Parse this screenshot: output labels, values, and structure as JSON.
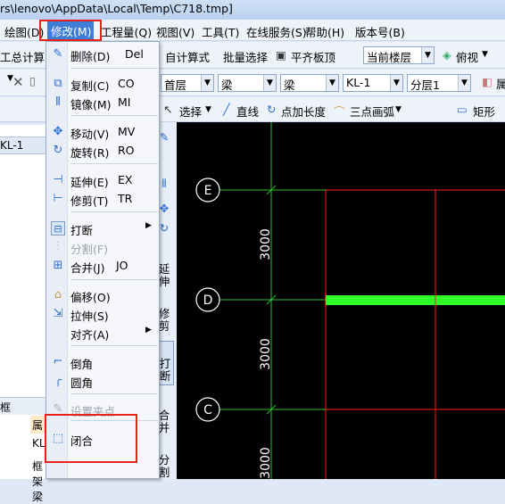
{
  "titlebar": {
    "text": "rs\\lenovo\\AppData\\Local\\Temp\\C718.tmp]"
  },
  "menubar": {
    "items": [
      "绘图(D)",
      "修改(M)",
      "工程量(Q)",
      "视图(V)",
      "工具(T)",
      "在线服务(S)",
      "帮助(H)",
      "版本号(B)"
    ]
  },
  "toolbar1": {
    "left_label": "工总计算",
    "calc": "自计算式",
    "batch": "批量选择",
    "flat": "平齐板顶",
    "floor_select": "当前楼层",
    "view": "俯视"
  },
  "toolbar2": {
    "floor": "首层",
    "type1": "梁",
    "type2": "梁",
    "element": "KL-1",
    "layer": "分层1",
    "right_btn": "属"
  },
  "toolbar3": {
    "select": "选择",
    "line": "直线",
    "point_len": "点加长度",
    "arc": "三点画弧",
    "rect": "矩形"
  },
  "leftpanel": {
    "row1": "KL-1",
    "bottom_rows": [
      "框",
      "属",
      "KL",
      "框架梁"
    ]
  },
  "context_menu": {
    "items": [
      {
        "icon": "eraser-icon",
        "label": "删除(D)",
        "shortcut": "Del"
      },
      {
        "icon": "copy-icon",
        "label": "复制(C)",
        "shortcut": "CO"
      },
      {
        "icon": "mirror-icon",
        "label": "镜像(M)",
        "shortcut": "MI"
      },
      {
        "icon": "move-icon",
        "label": "移动(V)",
        "shortcut": "MV"
      },
      {
        "icon": "rotate-icon",
        "label": "旋转(R)",
        "shortcut": "RO"
      },
      {
        "icon": "extend-icon",
        "label": "延伸(E)",
        "shortcut": "EX"
      },
      {
        "icon": "trim-icon",
        "label": "修剪(T)",
        "shortcut": "TR"
      },
      {
        "icon": "break-icon",
        "label": "打断",
        "shortcut": ""
      },
      {
        "icon": "split-icon",
        "label": "分割(F)",
        "shortcut": ""
      },
      {
        "icon": "merge-icon",
        "label": "合并(J)",
        "shortcut": "JO"
      },
      {
        "icon": "offset-icon",
        "label": "偏移(O)",
        "shortcut": ""
      },
      {
        "icon": "stretch-icon",
        "label": "拉伸(S)",
        "shortcut": ""
      },
      {
        "icon": "align-icon",
        "label": "对齐(A)",
        "shortcut": ""
      },
      {
        "icon": "chamfer-icon",
        "label": "倒角",
        "shortcut": ""
      },
      {
        "icon": "fillet-icon",
        "label": "圆角",
        "shortcut": ""
      },
      {
        "icon": "grip-icon",
        "label": "设置夹点",
        "shortcut": ""
      },
      {
        "icon": "close-shape-icon",
        "label": "闭合",
        "shortcut": ""
      }
    ]
  },
  "vertical_toolbar": {
    "extend": "延伸",
    "trim": "修剪",
    "break": "打断",
    "merge": "合并",
    "split": "分割"
  },
  "canvas": {
    "axis_labels": [
      "E",
      "D",
      "C"
    ],
    "dimensions": [
      "3000",
      "3000",
      "3000"
    ]
  },
  "colors": {
    "canvas_bg": "#000000",
    "grid_green": "#2fbf2f",
    "beam_green": "#31ff2a",
    "column_red": "#d21818",
    "highlight_red": "#e8221b",
    "menu_active": "#3f7ed6"
  }
}
